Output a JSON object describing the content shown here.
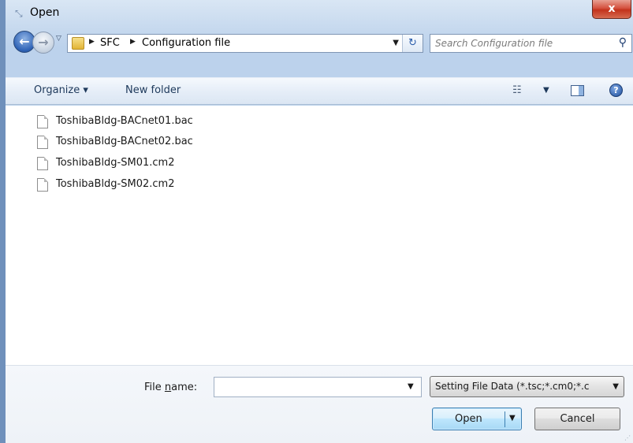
{
  "window": {
    "title": "Open",
    "title_icon": "open-dialog-icon",
    "close_label": "x"
  },
  "nav": {
    "back_icon": "back-arrow-icon",
    "forward_icon": "forward-arrow-icon",
    "recent_icon": "recent-pages-dropdown-icon"
  },
  "address": {
    "folder_icon": "folder-icon",
    "crumbs": [
      "SFC",
      "Configuration file"
    ],
    "refresh_icon": "refresh-icon"
  },
  "search": {
    "placeholder": "Search Configuration file",
    "icon": "search-icon"
  },
  "toolbar": {
    "organize_label": "Organize ▾",
    "new_folder_label": "New folder",
    "views_icon": "change-view-icon",
    "preview_icon": "preview-pane-icon",
    "help_icon": "help-icon"
  },
  "files": [
    {
      "name": "ToshibaBldg-BACnet01.bac"
    },
    {
      "name": "ToshibaBldg-BACnet02.bac"
    },
    {
      "name": "ToshibaBldg-SM01.cm2"
    },
    {
      "name": "ToshibaBldg-SM02.cm2"
    }
  ],
  "filename": {
    "label_prefix": "File ",
    "label_accel": "n",
    "label_suffix": "ame:",
    "value": ""
  },
  "filetype": {
    "selected": "Setting File Data (*.tsc;*.cm0;*.c"
  },
  "buttons": {
    "open_label": "Open",
    "cancel_label": "Cancel"
  },
  "colors": {
    "frame_accent": "#b9cfe9",
    "close_button": "#c2321c",
    "link_text": "#1e395b"
  }
}
